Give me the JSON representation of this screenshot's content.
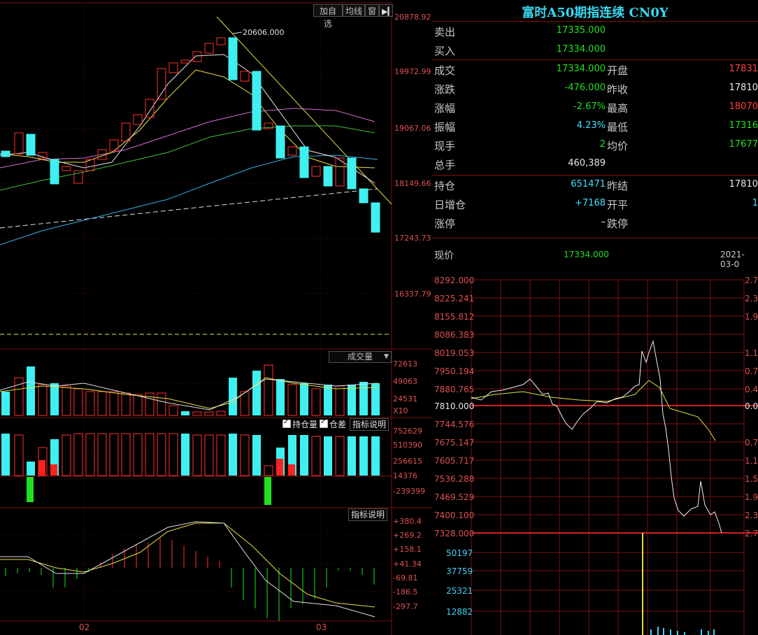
{
  "toolbar": {
    "add_watch": "加自选",
    "ma_line": "均线",
    "window": "窗",
    "exit_icon": "exit-icon"
  },
  "kline": {
    "price_axis": [
      "20878.92",
      "19972.99",
      "19067.06",
      "18149.66",
      "17243.73",
      "16337.79"
    ],
    "high_marker": "20606.000",
    "x_labels": [
      "02",
      "03"
    ]
  },
  "volume_panel": {
    "selector": "成交量",
    "axis": [
      "72613",
      "49063",
      "24531",
      "X10"
    ]
  },
  "oi_panel": {
    "check_oi": "持仓量",
    "check_diff": "仓差",
    "indicator_btn": "指标说明",
    "axis": [
      "752629",
      "510390",
      "256615",
      "14376",
      "-239399"
    ]
  },
  "macd_panel": {
    "indicator_btn": "指标说明",
    "axis": [
      "+380.4",
      "+269.2",
      "+158.1",
      "+41.34",
      "-69.81",
      "-186.5",
      "-297.7"
    ]
  },
  "quote": {
    "title": "富时A50期指连续 CN0Y",
    "sell_label": "卖出",
    "sell": "17335.000",
    "buy_label": "买入",
    "buy": "17334.000",
    "rows": [
      {
        "l1": "成交",
        "v1": "17334.000",
        "l2": "开盘",
        "v2": "17831"
      },
      {
        "l1": "涨跌",
        "v1": "-476.000",
        "l2": "昨收",
        "v2": "17810"
      },
      {
        "l1": "涨幅",
        "v1": "-2.67%",
        "l2": "最高",
        "v2": "18070"
      },
      {
        "l1": "振幅",
        "v1": "4.23%",
        "l2": "最低",
        "v2": "17316"
      },
      {
        "l1": "现手",
        "v1": "2",
        "l2": "均价",
        "v2": "17677"
      },
      {
        "l1": "总手",
        "v1": "460,389",
        "l2": "",
        "v2": ""
      }
    ],
    "rows2": [
      {
        "l1": "持仓",
        "v1": "651471",
        "l2": "昨结",
        "v2": "17810"
      },
      {
        "l1": "日增仓",
        "v1": "+7168",
        "l2": "开平",
        "v2": "1"
      },
      {
        "l1": "涨停",
        "v1": "–",
        "l2": "跌停",
        "v2": ""
      }
    ],
    "now_label": "现价",
    "now_value": "17334.000",
    "date": "2021-03-0"
  },
  "intraday": {
    "price_axis": [
      "8292.000",
      "8225.241",
      "8155.812",
      "8086.383",
      "8019.053",
      "7950.194",
      "7880.765",
      "7810.000",
      "7744.576",
      "7675.147",
      "7605.717",
      "7536.288",
      "7469.529",
      "7400.100",
      "7328.000"
    ],
    "pct_axis": [
      "2.7",
      "2.3",
      "1.9",
      "1.5",
      "1.1",
      "0.7",
      "0.4",
      "0.0",
      "0.4",
      "0.7",
      "1.1",
      "1.5",
      "1.9",
      "2.3",
      "2.7"
    ],
    "vol_axis": [
      "50197",
      "37759",
      "25321",
      "12882"
    ]
  },
  "colors": {
    "up": "#ff3030",
    "down": "#40f0f0",
    "grid": "#7a1010",
    "title": "#3ad6f0"
  }
}
